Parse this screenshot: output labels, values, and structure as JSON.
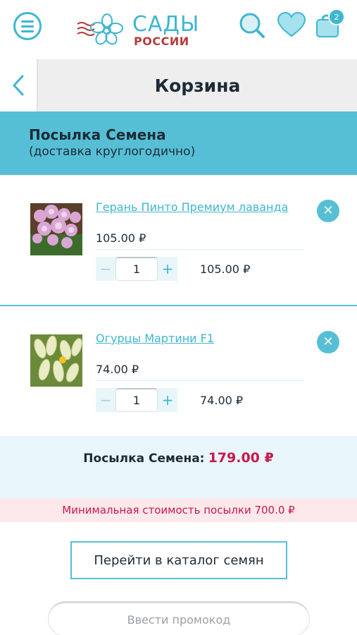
{
  "header": {
    "logo_top": "САДЫ",
    "logo_bottom": "РОССИИ",
    "cart_count": "2",
    "icons": [
      "menu-icon",
      "search-icon",
      "heart-icon",
      "shopping-bag-icon"
    ],
    "accent_color": "#3fb6cf",
    "brand_red": "#b43c3c"
  },
  "titlebar": {
    "title": "Корзина",
    "back_icon": "chevron-left-icon"
  },
  "parcel": {
    "title": "Посылка Семена",
    "subtitle": "(доставка круглогодично)"
  },
  "items": [
    {
      "name": "Герань Пинто Премиум лаванда",
      "price": "105.00 ₽",
      "qty_minus": "−",
      "qty": "1",
      "qty_plus": "+",
      "total": "105.00 ₽"
    },
    {
      "name": "Огурцы Мартини F1",
      "price": "74.00 ₽",
      "qty_minus": "−",
      "qty": "1",
      "qty_plus": "+",
      "total": "74.00 ₽"
    }
  ],
  "summary": {
    "label": "Посылка Семена:",
    "value": "179.00 ₽"
  },
  "warning": "Минимальная стоимость посылки 700.0 ₽",
  "catalog_button": "Перейти в каталог семян",
  "promo_placeholder": "Ввести промокод",
  "colors": {
    "parcel_bg": "#56bfd6",
    "summary_bg": "#e9f6fb",
    "warning_bg": "#fde8ec",
    "price_red": "#c8194b"
  }
}
